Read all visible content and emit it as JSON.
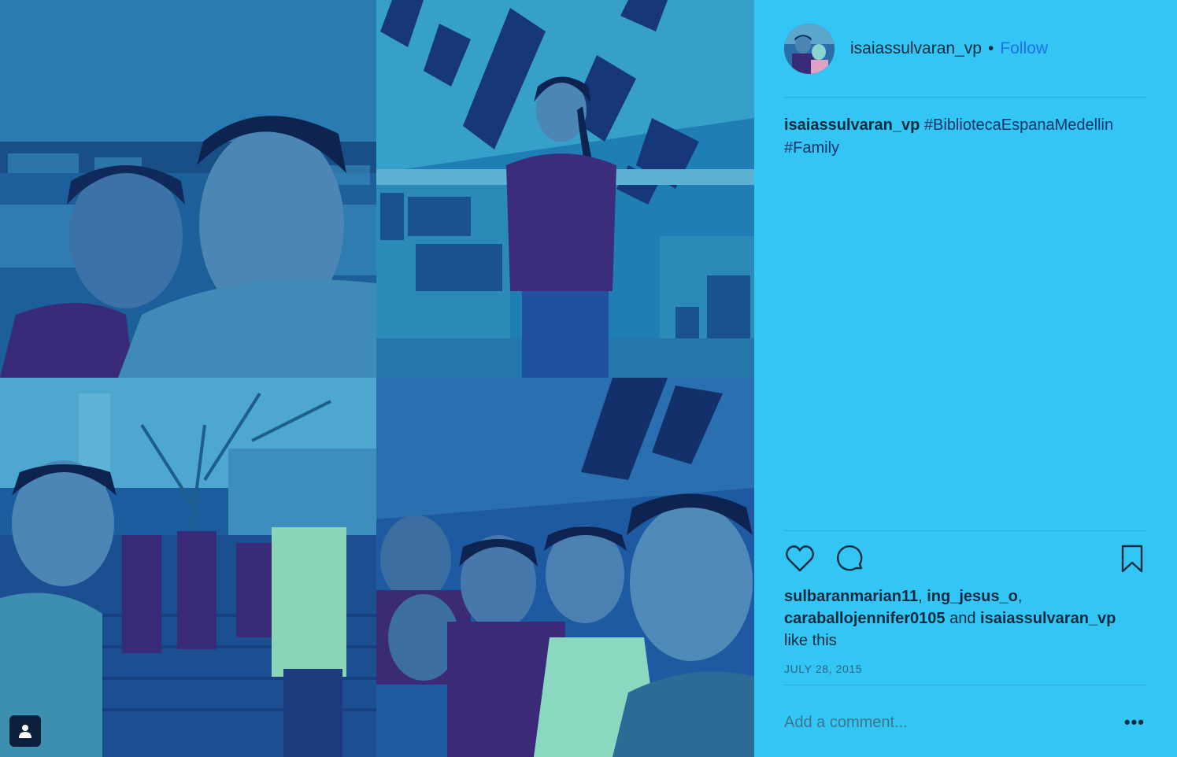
{
  "post": {
    "username": "isaiassulvaran_vp",
    "separator": "•",
    "follow_label": "Follow"
  },
  "caption": {
    "username": "isaiassulvaran_vp",
    "hashtag_1": "#BibliotecaEspanaMedellin",
    "hashtag_2": "#Family"
  },
  "icons": {
    "like": "heart-icon",
    "comment": "comment-icon",
    "save": "bookmark-icon",
    "tag": "person-tag-icon",
    "more": "more-options-icon"
  },
  "likes": {
    "liker_1": "sulbaranmarian11",
    "sep_1": ", ",
    "liker_2": "ing_jesus_o",
    "sep_2": ",",
    "liker_3": "caraballojennifer0105",
    "and_text": " and ",
    "liker_4": "isaiassulvaran_vp",
    "suffix": "like this"
  },
  "date": "JULY 28, 2015",
  "comment": {
    "placeholder": "Add a comment...",
    "more_label": "•••"
  },
  "colors": {
    "sidebar_bg": "#33c5f3",
    "follow": "#1e6ff0",
    "photo_tint": "#1a4fa8"
  }
}
